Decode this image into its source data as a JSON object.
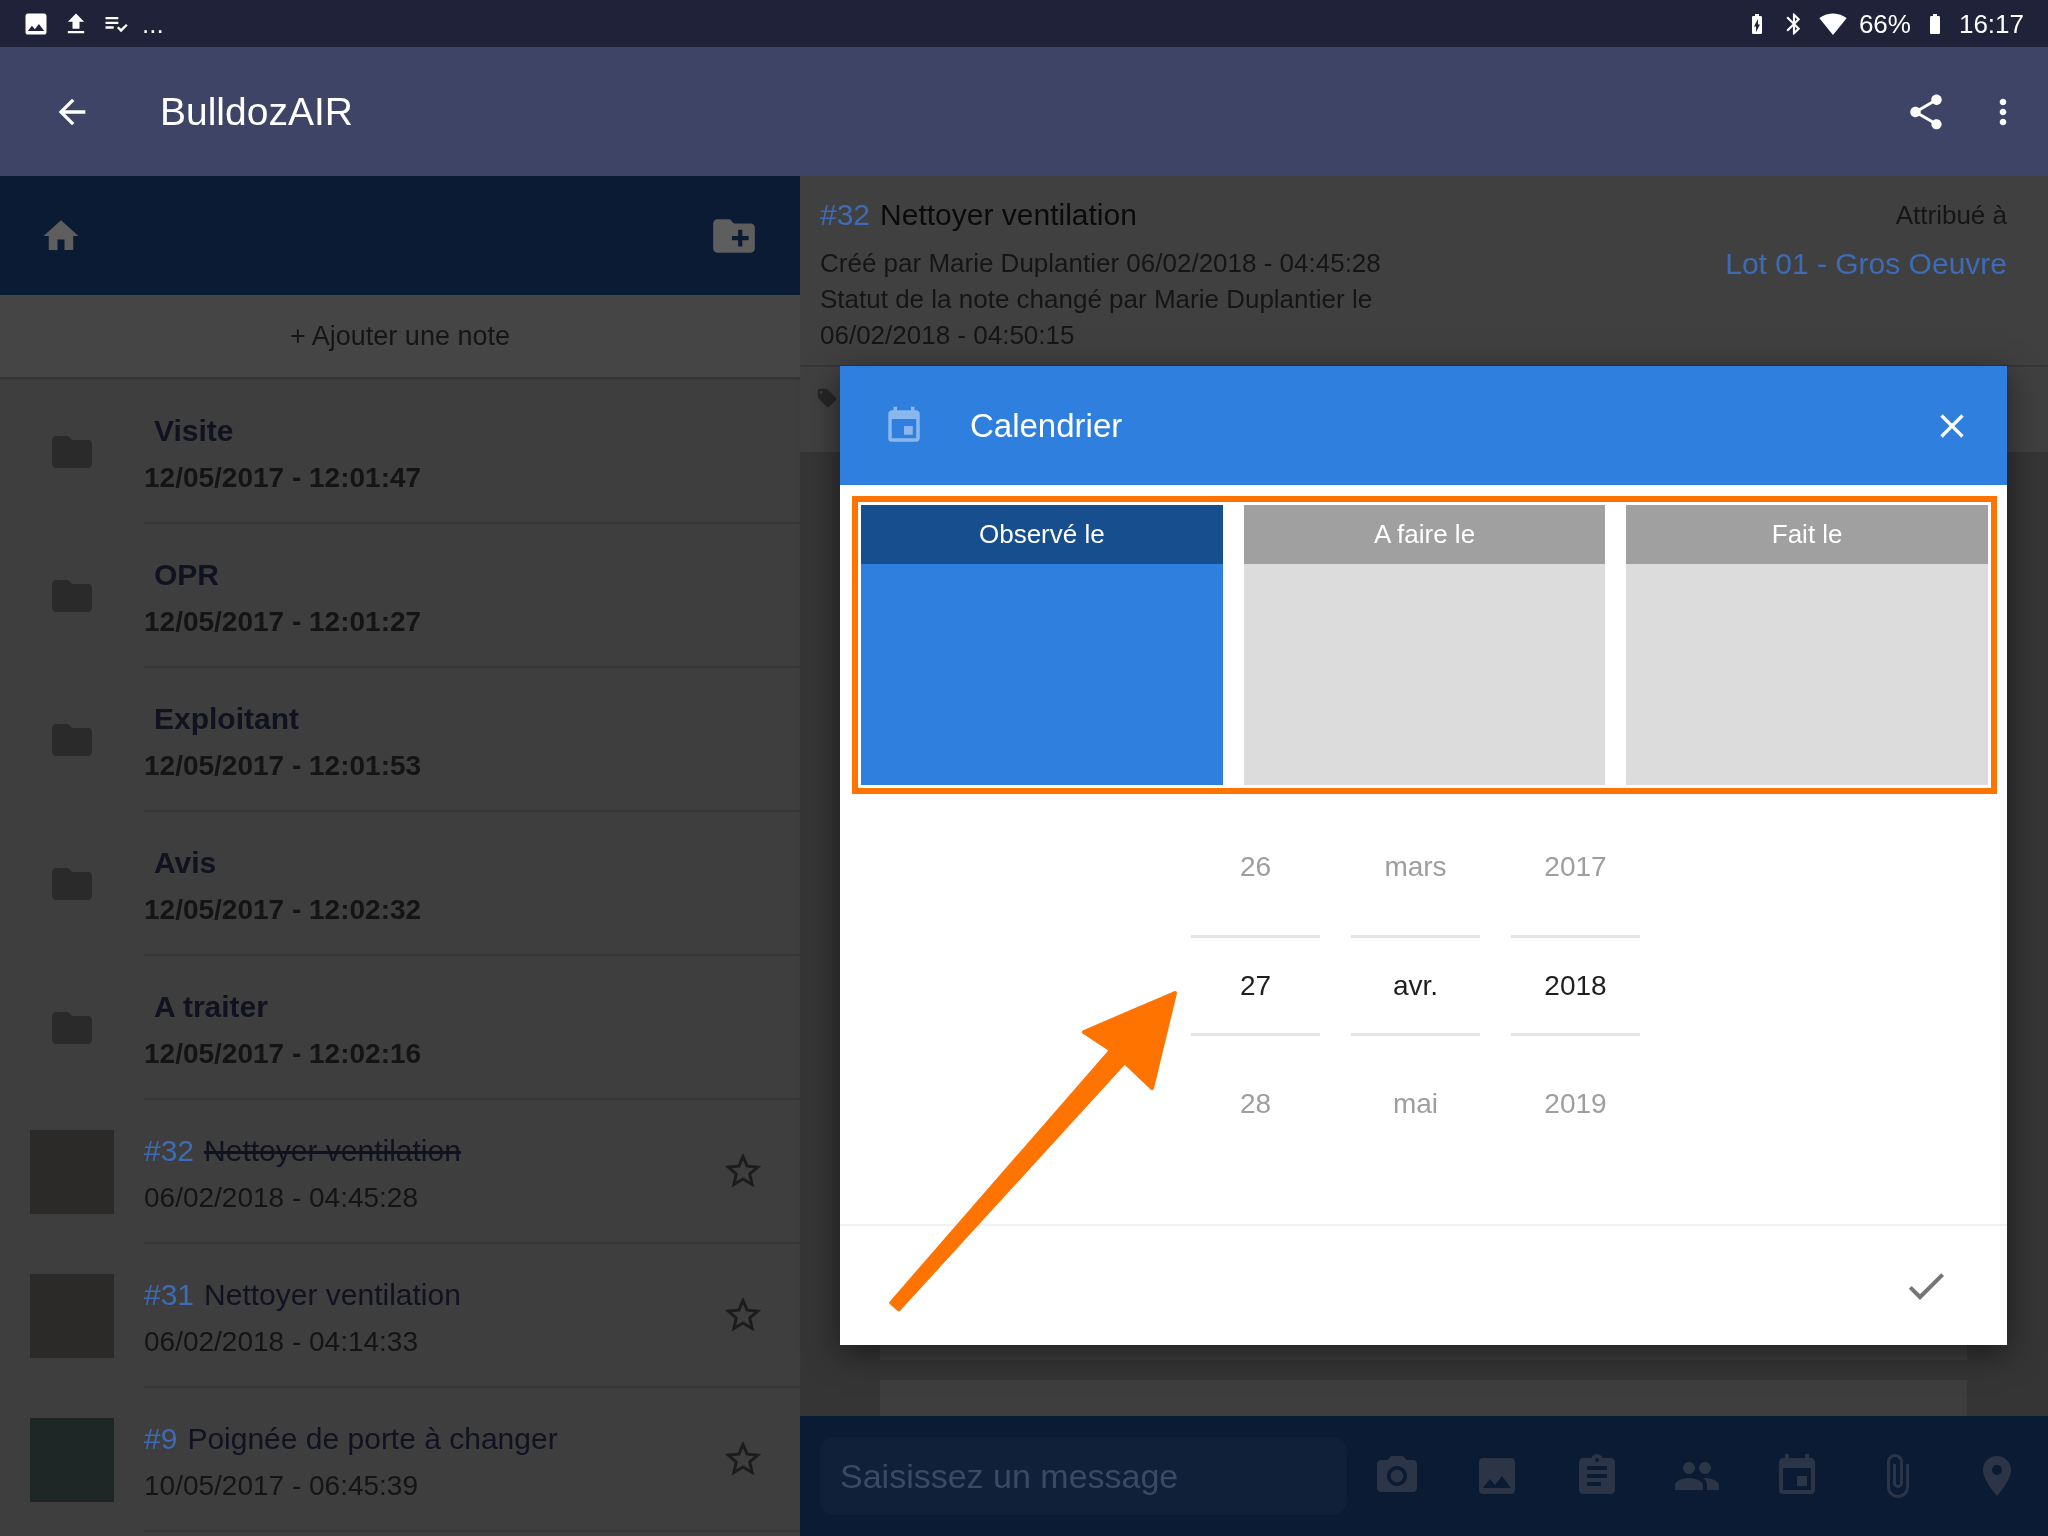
{
  "status_bar": {
    "overflow": "...",
    "battery": "66%",
    "time": "16:17"
  },
  "app_bar": {
    "title": "BulldozAIR"
  },
  "sidebar": {
    "add_note": "+ Ajouter une note",
    "items": [
      {
        "kind": "folder",
        "title": "Visite",
        "date": "12/05/2017 - 12:01:47"
      },
      {
        "kind": "folder",
        "title": "OPR",
        "date": "12/05/2017 - 12:01:27"
      },
      {
        "kind": "folder",
        "title": "Exploitant",
        "date": "12/05/2017 - 12:01:53"
      },
      {
        "kind": "folder",
        "title": "Avis",
        "date": "12/05/2017 - 12:02:32"
      },
      {
        "kind": "folder",
        "title": "A traiter",
        "date": "12/05/2017 - 12:02:16"
      },
      {
        "kind": "note",
        "number": "#32",
        "title": "Nettoyer ventilation",
        "date": "06/02/2018 - 04:45:28",
        "done": true,
        "starred": false
      },
      {
        "kind": "note",
        "number": "#31",
        "title": "Nettoyer ventilation",
        "date": "06/02/2018 - 04:14:33",
        "done": false,
        "starred": false
      },
      {
        "kind": "note",
        "number": "#9",
        "title": "Poignée de porte à changer",
        "date": "10/05/2017 - 06:45:39",
        "done": false,
        "starred": false
      }
    ]
  },
  "note": {
    "number": "#32",
    "title": "Nettoyer ventilation",
    "created": "Créé par Marie Duplantier 06/02/2018 - 04:45:28",
    "status_change": "Statut de la note changé par Marie Duplantier le 06/02/2018 - 04:50:15",
    "assigned_label": "Attribué à",
    "assigned_to": "Lot 01 - Gros Oeuvre"
  },
  "composer": {
    "placeholder": "Saisissez un message"
  },
  "dialog": {
    "title": "Calendrier",
    "tabs": [
      {
        "label": "Observé le",
        "selected": true
      },
      {
        "label": "A faire le",
        "selected": false
      },
      {
        "label": "Fait le",
        "selected": false
      }
    ],
    "picker": {
      "columns": [
        {
          "items": [
            {
              "text": "26",
              "selected": false
            },
            {
              "text": "27",
              "selected": true
            },
            {
              "text": "28",
              "selected": false
            }
          ]
        },
        {
          "items": [
            {
              "text": "mars",
              "selected": false
            },
            {
              "text": "avr.",
              "selected": true
            },
            {
              "text": "mai",
              "selected": false
            }
          ]
        },
        {
          "items": [
            {
              "text": "2017",
              "selected": false
            },
            {
              "text": "2018",
              "selected": true
            },
            {
              "text": "2019",
              "selected": false
            }
          ]
        }
      ]
    }
  }
}
